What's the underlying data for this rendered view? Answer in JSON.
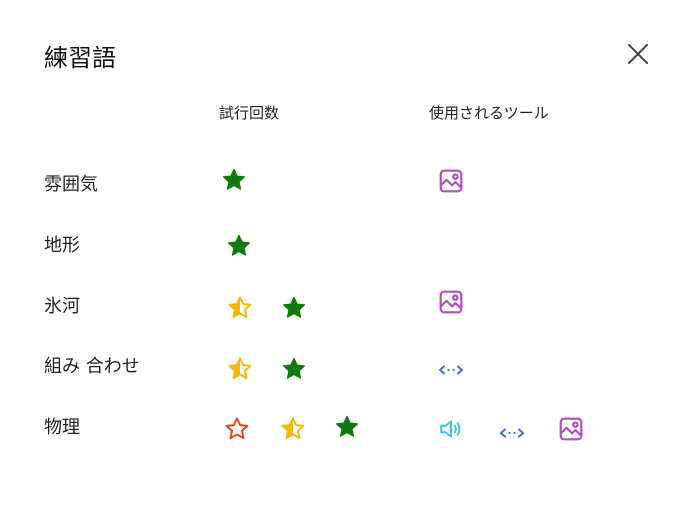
{
  "dialog": {
    "title": "練習語"
  },
  "columns": {
    "attempts_label": "試行回数",
    "tools_label": "使用されるツール"
  },
  "colors": {
    "star_full": "#117a0f",
    "star_half": "#f2b90c",
    "star_empty": "#e2461b",
    "tool_image": "#b24cc2",
    "tool_split": "#3a6de0",
    "tool_audio": "#3ec6d8",
    "close": "#444444"
  },
  "rows": [
    {
      "label": "雰囲気",
      "attempts": [
        "star-full"
      ],
      "tools": [
        "image-icon"
      ]
    },
    {
      "label": "地形",
      "attempts": [
        "star-full"
      ],
      "tools": []
    },
    {
      "label": "氷河",
      "attempts": [
        "star-half",
        "star-full"
      ],
      "tools": [
        "image-icon"
      ]
    },
    {
      "label": "組み 合わせ",
      "attempts": [
        "star-half",
        "star-full"
      ],
      "tools": [
        "split-icon"
      ]
    },
    {
      "label": "物理",
      "attempts": [
        "star-empty",
        "star-half",
        "star-full"
      ],
      "tools": [
        "speaker-icon",
        "split-icon",
        "image-icon"
      ]
    }
  ]
}
